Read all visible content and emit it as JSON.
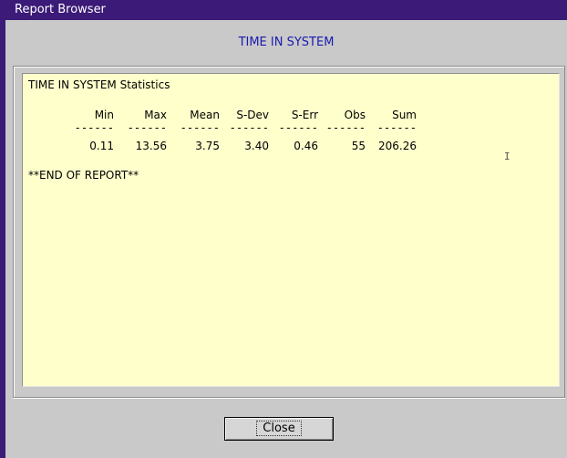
{
  "window": {
    "title": "Report Browser"
  },
  "report": {
    "header": "TIME IN SYSTEM",
    "title": "TIME IN SYSTEM Statistics",
    "columns": [
      "Min",
      "Max",
      "Mean",
      "S-Dev",
      "S-Err",
      "Obs",
      "Sum"
    ],
    "separator": "------",
    "values": [
      "0.11",
      "13.56",
      "3.75",
      "3.40",
      "0.46",
      "55",
      "206.26"
    ],
    "end_text": "**END OF REPORT**"
  },
  "buttons": {
    "close_label": "Close"
  },
  "colors": {
    "titlebar": "#3b1a78",
    "header_text": "#1a1ab0",
    "report_bg": "#ffffcc"
  },
  "icons": {
    "text_cursor": "i-beam-cursor-icon"
  }
}
